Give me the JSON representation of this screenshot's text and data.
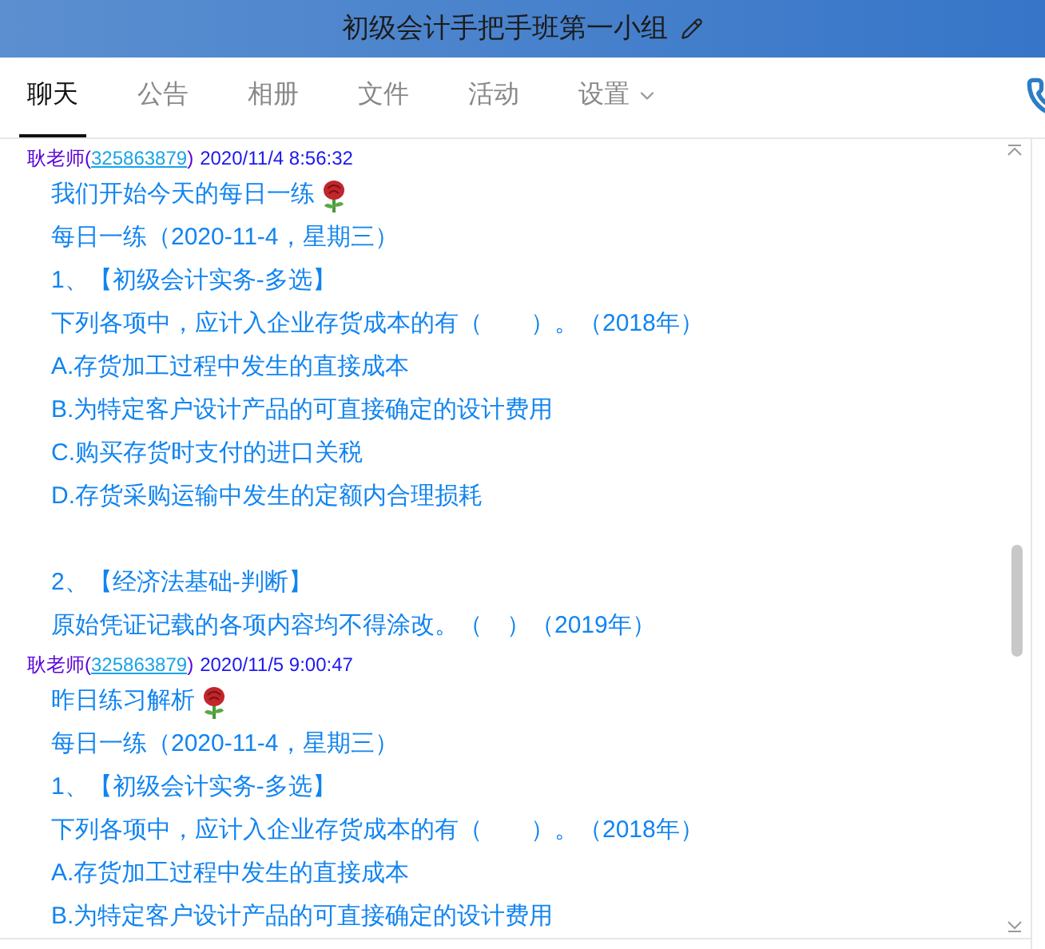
{
  "window": {
    "title": "初级会计手把手班第一小组"
  },
  "tabs": [
    {
      "label": "聊天",
      "selected": true,
      "dropdown": false
    },
    {
      "label": "公告",
      "selected": false,
      "dropdown": false
    },
    {
      "label": "相册",
      "selected": false,
      "dropdown": false
    },
    {
      "label": "文件",
      "selected": false,
      "dropdown": false
    },
    {
      "label": "活动",
      "selected": false,
      "dropdown": false
    },
    {
      "label": "设置",
      "selected": false,
      "dropdown": true
    }
  ],
  "messages": [
    {
      "sender": "耿老师",
      "open_paren": "(",
      "id": "325863879",
      "close_paren": ")",
      "time": "2020/11/4 8:56:32",
      "lines": [
        {
          "kind": "text",
          "text": "我们开始今天的每日一练",
          "emoji": true
        },
        {
          "kind": "text",
          "text": "每日一练（2020-11-4，星期三）",
          "emoji": false
        },
        {
          "kind": "text",
          "text": "1、【初级会计实务-多选】",
          "emoji": false
        },
        {
          "kind": "text",
          "text": "下列各项中，应计入企业存货成本的有（　　）。（2018年）",
          "emoji": false
        },
        {
          "kind": "text",
          "text": "A.存货加工过程中发生的直接成本",
          "emoji": false
        },
        {
          "kind": "text",
          "text": "B.为特定客户设计产品的可直接确定的设计费用",
          "emoji": false
        },
        {
          "kind": "text",
          "text": "C.购买存货时支付的进口关税",
          "emoji": false
        },
        {
          "kind": "text",
          "text": "D.存货采购运输中发生的定额内合理损耗",
          "emoji": false
        },
        {
          "kind": "blank"
        },
        {
          "kind": "text",
          "text": "2、【经济法基础-判断】",
          "emoji": false
        },
        {
          "kind": "text",
          "text": "原始凭证记载的各项内容均不得涂改。（　）（2019年）",
          "emoji": false
        }
      ]
    },
    {
      "sender": "耿老师",
      "open_paren": "(",
      "id": "325863879",
      "close_paren": ")",
      "time": "2020/11/5 9:00:47",
      "lines": [
        {
          "kind": "text",
          "text": "昨日练习解析",
          "emoji": true
        },
        {
          "kind": "text",
          "text": "每日一练（2020-11-4，星期三）",
          "emoji": false
        },
        {
          "kind": "text",
          "text": "1、【初级会计实务-多选】",
          "emoji": false
        },
        {
          "kind": "text",
          "text": "下列各项中，应计入企业存货成本的有（　　）。（2018年）",
          "emoji": false
        },
        {
          "kind": "text",
          "text": "A.存货加工过程中发生的直接成本",
          "emoji": false
        },
        {
          "kind": "text",
          "text": "B.为特定客户设计产品的可直接确定的设计费用",
          "emoji": false
        }
      ]
    }
  ]
}
